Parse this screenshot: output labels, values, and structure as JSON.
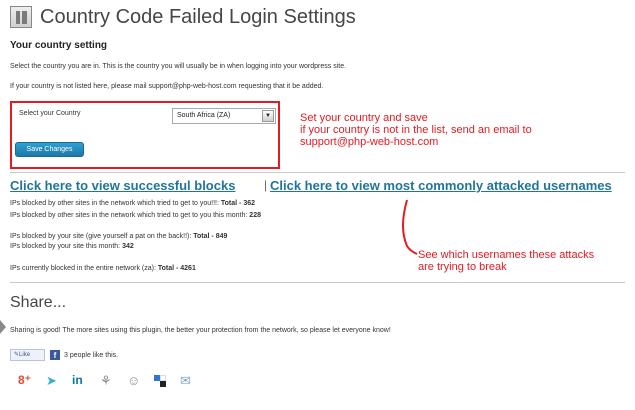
{
  "page": {
    "title": "Country Code Failed Login Settings",
    "section_heading": "Your country setting",
    "desc1": "Select the country you are in. This is the country you will usually be in when logging into your wordpress site.",
    "desc2": "If your country is not listed here, please mail support@php-web-host.com requesting that it be added."
  },
  "form": {
    "country_label": "Select your Country",
    "country_value": "South Africa (ZA)",
    "save_label": "Save Changes"
  },
  "annotations": {
    "box_line1": "Set your country and save",
    "box_line2": "if your country is not in the list, send an email to",
    "box_line3": "support@php-web-host.com",
    "usernames_line1": "See which usernames these attacks",
    "usernames_line2": "are trying to break"
  },
  "links": {
    "successful_blocks": "Click here to view successful blocks",
    "separator": "|",
    "attacked_usernames": "Click here to view most commonly attacked usernames"
  },
  "stats": {
    "network_total_text": "IPs blocked by other sites in the network which tried to get to you!!!: ",
    "network_total_value": "Total - 362",
    "network_month_text": "IPs blocked by other sites in the network which tried to get to you this month: ",
    "network_month_value": "228",
    "site_total_text": "IPs blocked by your site (give yourself a pat on the back!!): ",
    "site_total_value": "Total - 849",
    "site_month_text": "IPs blocked by your site this month: ",
    "site_month_value": "342",
    "current_text": "IPs currently blocked in the entire network (za): ",
    "current_value": "Total - 4261"
  },
  "share": {
    "heading": "Share...",
    "text": "Sharing is good! The more sites using this plugin, the better your protection from the network, so please let everyone know!",
    "like_label": "Like",
    "like_count": "3 people like this.",
    "icons": [
      "google-plus-icon",
      "twitter-icon",
      "linkedin-icon",
      "stumbleupon-icon",
      "reddit-icon",
      "delicious-icon",
      "email-icon"
    ]
  },
  "colors": {
    "annotation_red": "#e31b23",
    "link_blue": "#21759b",
    "button_blue": "#2e9fd2"
  }
}
